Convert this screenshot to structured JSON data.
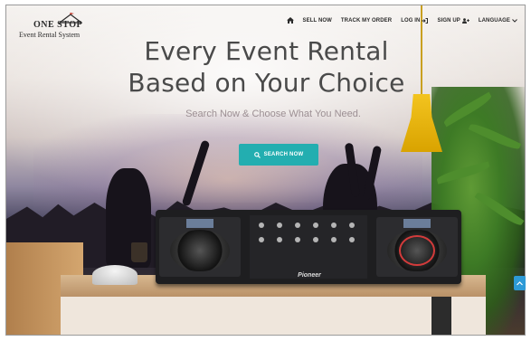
{
  "logo": {
    "line1": "ONE STOP",
    "line2": "Event Rental System"
  },
  "nav": {
    "home_icon": "home-icon",
    "sell_now": "SELL NOW",
    "track_order": "TRACK MY ORDER",
    "login": "LOG IN",
    "login_icon": "sign-in-icon",
    "signup": "SIGN UP",
    "signup_icon": "user-plus-icon",
    "language": "LANGUAGE",
    "language_icon": "chevron-down-icon"
  },
  "hero": {
    "title_line1": "Every Event Rental",
    "title_line2": "Based on Your Choice",
    "subtitle": "Search Now & Choose What You Need.",
    "search_button": "SEARCH NOW",
    "search_icon": "search-icon",
    "dj_brand": "Pioneer"
  },
  "scroll_top_icon": "chevron-up-icon",
  "colors": {
    "accent": "#23aeb0",
    "scroll_button": "#2d9ad7",
    "title": "#4a4a4a",
    "subtitle": "#9c8f93"
  }
}
